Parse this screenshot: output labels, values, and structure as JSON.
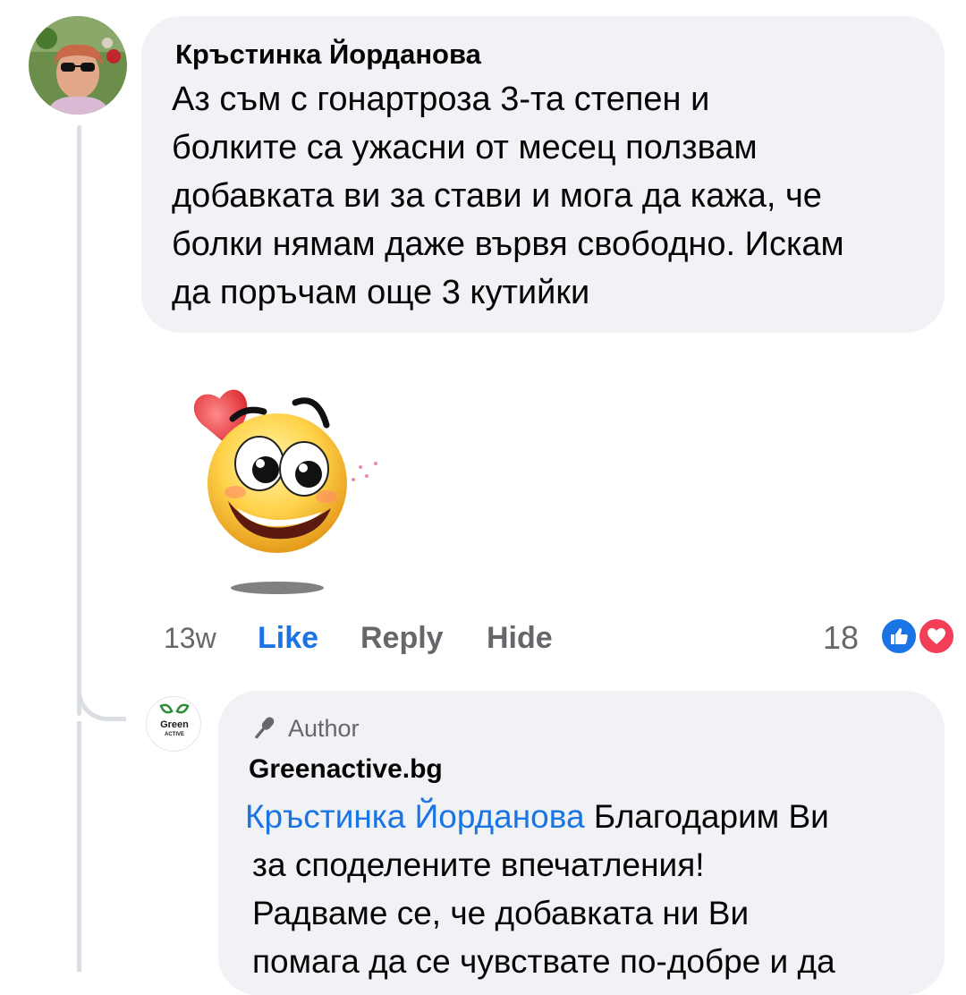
{
  "comment": {
    "author": "Кръстинка Йорданова",
    "text_lines": [
      "Аз съм с гонартроза 3-та степен и",
      "болките са ужасни от месец ползвам",
      "добавката ви за стави и мога да кажа, че",
      "болки нямам даже вървя свободно. Искам",
      "да поръчам още 3 кутийки"
    ],
    "sticker": "smiley-sticker-with-heart",
    "actions": {
      "time": "13w",
      "like": "Like",
      "reply": "Reply",
      "hide": "Hide"
    },
    "reaction_count": "18",
    "reactions": [
      "like-icon",
      "love-icon"
    ]
  },
  "reply": {
    "badge": "Author",
    "badge_icon": "microphone-icon",
    "author": "Greenactive.bg",
    "avatar_text": [
      "Green",
      "ACTIVE"
    ],
    "mention": "Кръстинка Йорданова",
    "first_line_rest": "Благодарим Ви",
    "text_lines": [
      "за споделените впечатления!",
      "Радваме се, че добавката ни Ви",
      "помага да се чувствате по-добре и да"
    ]
  },
  "colors": {
    "bubble": "#f0f2f5",
    "link": "#1b74e4",
    "muted": "#65676b",
    "love": "#f33e58"
  }
}
